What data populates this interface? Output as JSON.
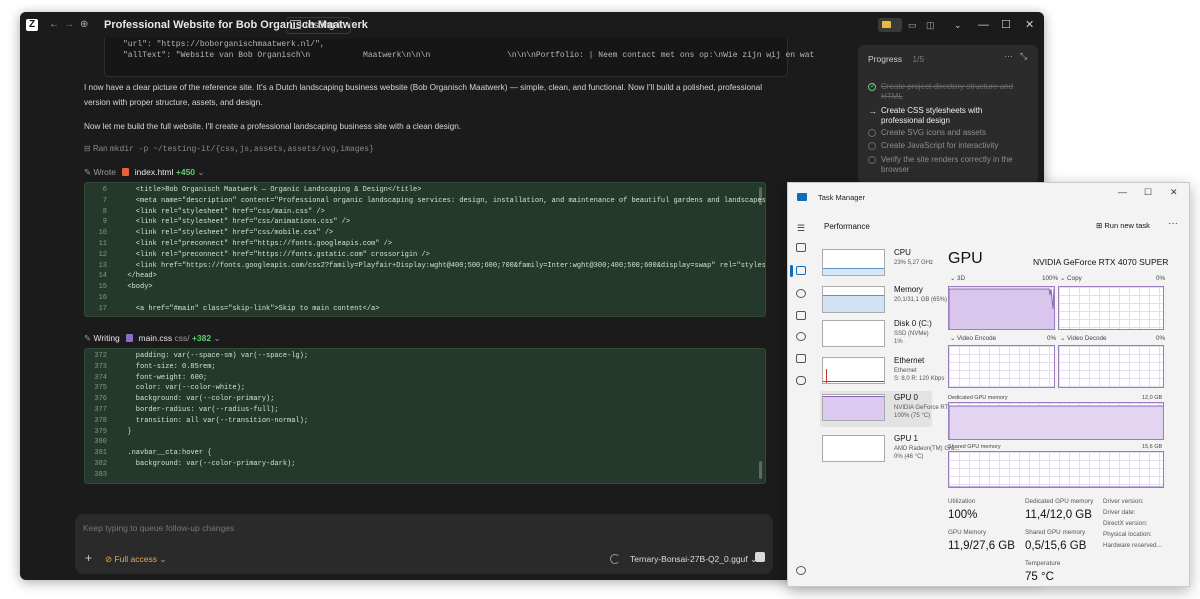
{
  "agent": {
    "title": "Professional Website for Bob Organisch Maatwerk",
    "folder": "testing-it",
    "logo": "Z",
    "code_top": [
      "\"url\": \"https://boborganischmaatwerk.nl/\",",
      "\"allText\": \"Website van Bob Organisch\\n           Maatwerk\\n\\n\\n                \\n\\n\\nPortfolio: | Neem contact met ons op:\\nWie zijn wij en wat"
    ],
    "paragraph1_line1": "I now have a clear picture of the reference site. It's a Dutch landscaping business website (Bob Organisch Maatwerk) — simple, clean, and functional. Now I'll build a polished, professional",
    "paragraph1_line2": "version with proper structure, assets, and design.",
    "paragraph2": "Now let me build the full website. I'll create a professional landscaping business site with a clean design.",
    "cmd_label": "Ran",
    "cmd": "mkdir -p ~/testing-it/{css,js,assets,assets/svg,images}",
    "file1": {
      "verb": "Wrote",
      "name": "index.html",
      "added": "+450"
    },
    "html_lines": [
      {
        "n": "6",
        "c": "    <title>Bob Organisch Maatwerk — Organic Landscaping & Design</title>"
      },
      {
        "n": "7",
        "c": "    <meta name=\"description\" content=\"Professional organic landscaping services: design, installation, and maintenance of beautiful gardens and landscapes.\" />"
      },
      {
        "n": "8",
        "c": "    <link rel=\"stylesheet\" href=\"css/main.css\" />"
      },
      {
        "n": "9",
        "c": "    <link rel=\"stylesheet\" href=\"css/animations.css\" />"
      },
      {
        "n": "10",
        "c": "    <link rel=\"stylesheet\" href=\"css/mobile.css\" />"
      },
      {
        "n": "11",
        "c": "    <link rel=\"preconnect\" href=\"https://fonts.googleapis.com\" />"
      },
      {
        "n": "12",
        "c": "    <link rel=\"preconnect\" href=\"https://fonts.gstatic.com\" crossorigin />"
      },
      {
        "n": "13",
        "c": "    <link href=\"https://fonts.googleapis.com/css2?family=Playfair+Display:wght@400;500;600;700&family=Inter:wght@300;400;500;600&display=swap\" rel=\"stylesheet\" />"
      },
      {
        "n": "14",
        "c": "  </head>"
      },
      {
        "n": "15",
        "c": "  <body>"
      },
      {
        "n": "16",
        "c": ""
      },
      {
        "n": "17",
        "c": "    <a href=\"#main\" class=\"skip-link\">Skip to main content</a>"
      }
    ],
    "file2": {
      "verb": "Writing",
      "name": "main.css",
      "dir": "css/",
      "added": "+382"
    },
    "css_lines": [
      {
        "n": "372",
        "c": "    padding: var(--space-sm) var(--space-lg);"
      },
      {
        "n": "373",
        "c": "    font-size: 0.85rem;"
      },
      {
        "n": "374",
        "c": "    font-weight: 600;"
      },
      {
        "n": "375",
        "c": "    color: var(--color-white);"
      },
      {
        "n": "376",
        "c": "    background: var(--color-primary);"
      },
      {
        "n": "377",
        "c": "    border-radius: var(--radius-full);"
      },
      {
        "n": "378",
        "c": "    transition: all var(--transition-normal);"
      },
      {
        "n": "379",
        "c": "  }"
      },
      {
        "n": "380",
        "c": ""
      },
      {
        "n": "381",
        "c": "  .navbar__cta:hover {"
      },
      {
        "n": "382",
        "c": "    background: var(--color-primary-dark);"
      },
      {
        "n": "383",
        "c": ""
      }
    ],
    "progress": {
      "title": "Progress",
      "count": "1/5",
      "items": [
        {
          "text": "Create project directory structure and HTML",
          "state": "done"
        },
        {
          "text": "Create CSS stylesheets with professional design",
          "state": "active"
        },
        {
          "text": "Create SVG icons and assets",
          "state": "pending"
        },
        {
          "text": "Create JavaScript for interactivity",
          "state": "pending"
        },
        {
          "text": "Verify the site renders correctly in the browser",
          "state": "pending"
        }
      ]
    },
    "input": {
      "placeholder": "Keep typing to queue follow-up changes",
      "access": "Full access",
      "model": "Ternary-Bonsai-27B-Q2_0.gguf"
    }
  },
  "taskmanager": {
    "title": "Task Manager",
    "section": "Performance",
    "run_new_task": "Run new task",
    "devices": [
      {
        "name": "CPU",
        "sub": [
          "23%  5,27 GHz"
        ]
      },
      {
        "name": "Memory",
        "sub": [
          "20,1/31,1 GB (65%)"
        ]
      },
      {
        "name": "Disk 0 (C:)",
        "sub": [
          "SSD (NVMe)",
          "1%"
        ]
      },
      {
        "name": "Ethernet",
        "sub": [
          "Ethernet",
          "S: 8,0  R: 120 Kbps"
        ]
      },
      {
        "name": "GPU 0",
        "sub": [
          "NVIDIA GeForce RTX ...",
          "100%  (75 °C)"
        ]
      },
      {
        "name": "GPU 1",
        "sub": [
          "AMD Radeon(TM) Gra...",
          "0%  (46 °C)"
        ]
      }
    ],
    "gpu": {
      "heading": "GPU",
      "model": "NVIDIA GeForce RTX 4070 SUPER",
      "graphs": [
        {
          "label": "3D",
          "pct": "100%"
        },
        {
          "label": "Copy",
          "pct": "0%"
        },
        {
          "label": "Video Encode",
          "pct": "0%"
        },
        {
          "label": "Video Decode",
          "pct": "0%"
        }
      ],
      "dedicated_label": "Dedicated GPU memory",
      "dedicated_max": "12,0 GB",
      "shared_label": "Shared GPU memory",
      "shared_max": "15,6 GB",
      "stats": {
        "utilization_label": "Utilization",
        "utilization": "100%",
        "dedicated_mem_label": "Dedicated GPU memory",
        "dedicated_mem": "11,4/12,0 GB",
        "gpu_mem_label": "GPU Memory",
        "gpu_mem": "11,9/27,6 GB",
        "shared_mem_label": "Shared GPU memory",
        "shared_mem": "0,5/15,6 GB",
        "temp_label": "Temperature",
        "temp": "75 °C"
      },
      "driver_labels": [
        "Driver version:",
        "Driver date:",
        "DirectX version:",
        "Physical location:",
        "Hardware reserved..."
      ]
    }
  }
}
